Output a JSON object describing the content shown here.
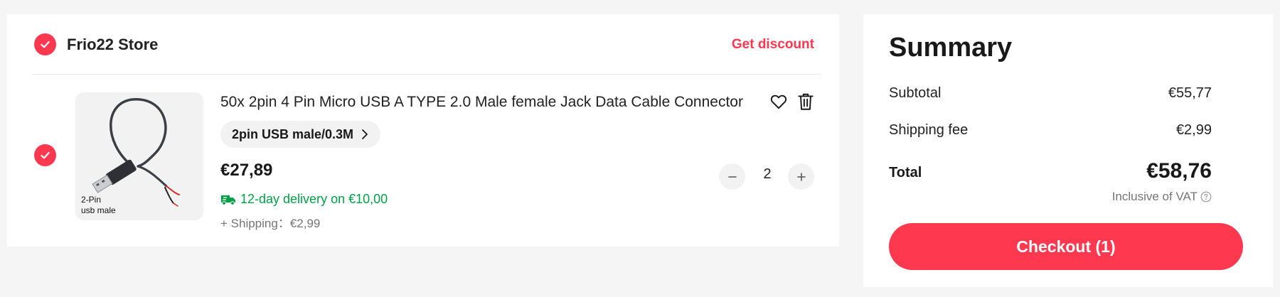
{
  "store": {
    "name": "Frio22 Store",
    "discount_label": "Get discount"
  },
  "item": {
    "title": "50x 2pin 4 Pin Micro USB A TYPE 2.0 Male female Jack Data Cable Connector",
    "image_caption_line1": "2-Pin",
    "image_caption_line2": "usb male",
    "variant": "2pin USB male/0.3M",
    "price": "€27,89",
    "delivery": "12-day delivery on €10,00",
    "shipping": "+ Shipping：€2,99",
    "quantity": "2"
  },
  "summary": {
    "title": "Summary",
    "subtotal_label": "Subtotal",
    "subtotal_value": "€55,77",
    "shipping_label": "Shipping fee",
    "shipping_value": "€2,99",
    "total_label": "Total",
    "total_value": "€58,76",
    "vat_note": "Inclusive of VAT",
    "checkout_label": "Checkout (1)"
  },
  "colors": {
    "accent": "#fd384f",
    "delivery_green": "#00a046",
    "muted": "#757575"
  },
  "icons": [
    "check-icon",
    "heart-icon",
    "trash-icon",
    "chevron-right-icon",
    "truck-icon",
    "minus-icon",
    "plus-icon",
    "help-circle-icon"
  ]
}
